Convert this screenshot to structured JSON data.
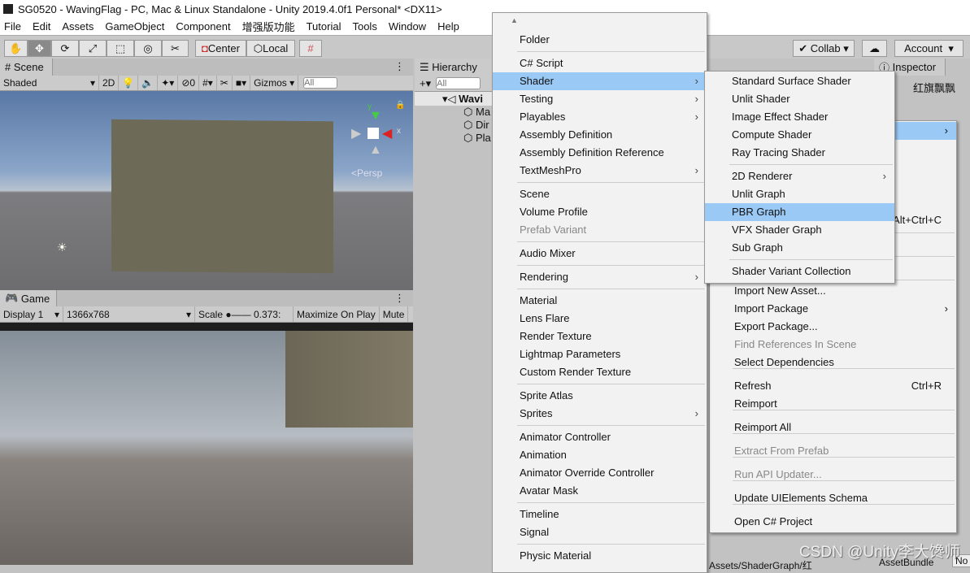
{
  "title": "SG0520 - WavingFlag - PC, Mac & Linux Standalone - Unity 2019.4.0f1 Personal* <DX11>",
  "menubar": [
    "File",
    "Edit",
    "Assets",
    "GameObject",
    "Component",
    "增强版功能",
    "Tutorial",
    "Tools",
    "Window",
    "Help"
  ],
  "toolbar": {
    "center": "Center",
    "local": "Local",
    "collab": "Collab",
    "account": "Account"
  },
  "scene": {
    "tab": "Scene",
    "shading": "Shaded",
    "mode_2d": "2D",
    "hidden_count": "0",
    "gizmos": "Gizmos",
    "search_placeholder": "All",
    "persp": "<Persp"
  },
  "game": {
    "tab": "Game",
    "display": "Display 1",
    "resolution": "1366x768",
    "scale_label": "Scale",
    "scale_value": "0.373:",
    "maximize": "Maximize On Play",
    "mute": "Mute"
  },
  "hierarchy": {
    "tab": "Hierarchy",
    "search_placeholder": "All",
    "scene_name": "Wavi",
    "items": [
      "Ma",
      "Dir",
      "Pla"
    ]
  },
  "inspector": {
    "tab": "Inspector",
    "object_name": "红旗飘飘",
    "assetbundle": "AssetBundle",
    "none": "No"
  },
  "project": {
    "path": "Assets/ShaderGraph/红"
  },
  "create_menu": [
    {
      "label": "Folder"
    },
    {
      "sep": true
    },
    {
      "label": "C# Script"
    },
    {
      "label": "Shader",
      "sub": true,
      "hl": true
    },
    {
      "label": "Testing",
      "sub": true
    },
    {
      "label": "Playables",
      "sub": true
    },
    {
      "label": "Assembly Definition"
    },
    {
      "label": "Assembly Definition Reference"
    },
    {
      "label": "TextMeshPro",
      "sub": true
    },
    {
      "sep": true
    },
    {
      "label": "Scene"
    },
    {
      "label": "Volume Profile"
    },
    {
      "label": "Prefab Variant",
      "dis": true
    },
    {
      "sep": true
    },
    {
      "label": "Audio Mixer"
    },
    {
      "sep": true
    },
    {
      "label": "Rendering",
      "sub": true
    },
    {
      "sep": true
    },
    {
      "label": "Material"
    },
    {
      "label": "Lens Flare"
    },
    {
      "label": "Render Texture"
    },
    {
      "label": "Lightmap Parameters"
    },
    {
      "label": "Custom Render Texture"
    },
    {
      "sep": true
    },
    {
      "label": "Sprite Atlas"
    },
    {
      "label": "Sprites",
      "sub": true
    },
    {
      "sep": true
    },
    {
      "label": "Animator Controller"
    },
    {
      "label": "Animation"
    },
    {
      "label": "Animator Override Controller"
    },
    {
      "label": "Avatar Mask"
    },
    {
      "sep": true
    },
    {
      "label": "Timeline"
    },
    {
      "label": "Signal"
    },
    {
      "sep": true
    },
    {
      "label": "Physic Material"
    }
  ],
  "shader_menu": [
    {
      "label": "Standard Surface Shader"
    },
    {
      "label": "Unlit Shader"
    },
    {
      "label": "Image Effect Shader"
    },
    {
      "label": "Compute Shader"
    },
    {
      "label": "Ray Tracing Shader"
    },
    {
      "sep": true
    },
    {
      "label": "2D Renderer",
      "sub": true
    },
    {
      "label": "Unlit Graph"
    },
    {
      "label": "PBR Graph",
      "hl": true
    },
    {
      "label": "VFX Shader Graph"
    },
    {
      "label": "Sub Graph"
    },
    {
      "sep": true
    },
    {
      "label": "Shader Variant Collection"
    }
  ],
  "assets_menu": {
    "shortcut_partial": "Alt+Ctrl+C",
    "items": [
      {
        "label": "Import New Asset..."
      },
      {
        "label": "Import Package",
        "sub": true
      },
      {
        "label": "Export Package..."
      },
      {
        "label": "Find References In Scene",
        "dis": true
      },
      {
        "label": "Select Dependencies"
      },
      {
        "label": "Refresh",
        "sc": "Ctrl+R"
      },
      {
        "label": "Reimport"
      },
      {
        "label": "Reimport All"
      },
      {
        "label": "Extract From Prefab",
        "dis": true
      },
      {
        "label": "Run API Updater...",
        "dis": true
      },
      {
        "label": "Update UIElements Schema"
      },
      {
        "label": "Open C# Project"
      }
    ]
  },
  "watermark": "CSDN @Unity李大馋师"
}
